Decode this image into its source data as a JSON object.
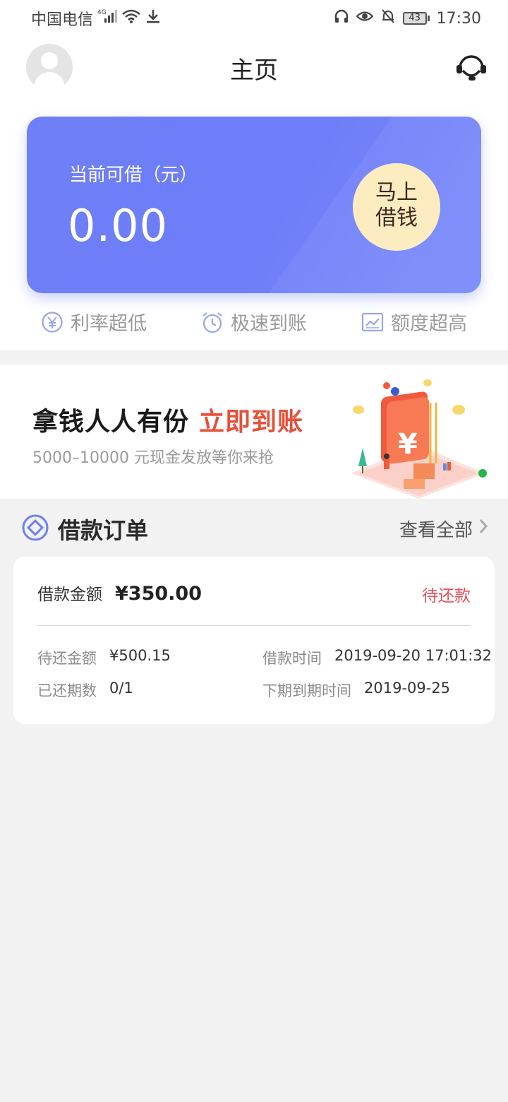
{
  "status_bar": {
    "carrier": "中国电信",
    "network": "4G",
    "battery": "43",
    "time": "17:30"
  },
  "header": {
    "title": "主页"
  },
  "loan_card": {
    "label": "当前可借（元）",
    "amount": "0.00",
    "button_line1": "马上",
    "button_line2": "借钱",
    "color": "#6f7ff7",
    "button_color": "#fdecc0"
  },
  "features": [
    {
      "label": "利率超低",
      "icon": "yen-circle-icon"
    },
    {
      "label": "极速到账",
      "icon": "alarm-clock-icon"
    },
    {
      "label": "额度超高",
      "icon": "trend-chart-icon"
    }
  ],
  "banner": {
    "title": "拿钱人人有份",
    "highlight": "立即到账",
    "subtitle": "5000–10000 元现金发放等你来抢",
    "highlight_color": "#e8503a"
  },
  "orders": {
    "section_title": "借款订单",
    "view_all": "查看全部",
    "item": {
      "amount_label": "借款金额",
      "amount": "¥350.00",
      "status": "待还款",
      "due_amount_label": "待还金额",
      "due_amount": "¥500.15",
      "borrow_time_label": "借款时间",
      "borrow_time": "2019-09-20 17:01:32",
      "paid_periods_label": "已还期数",
      "paid_periods": "0/1",
      "next_due_label": "下期到期时间",
      "next_due": "2019-09-25"
    }
  }
}
